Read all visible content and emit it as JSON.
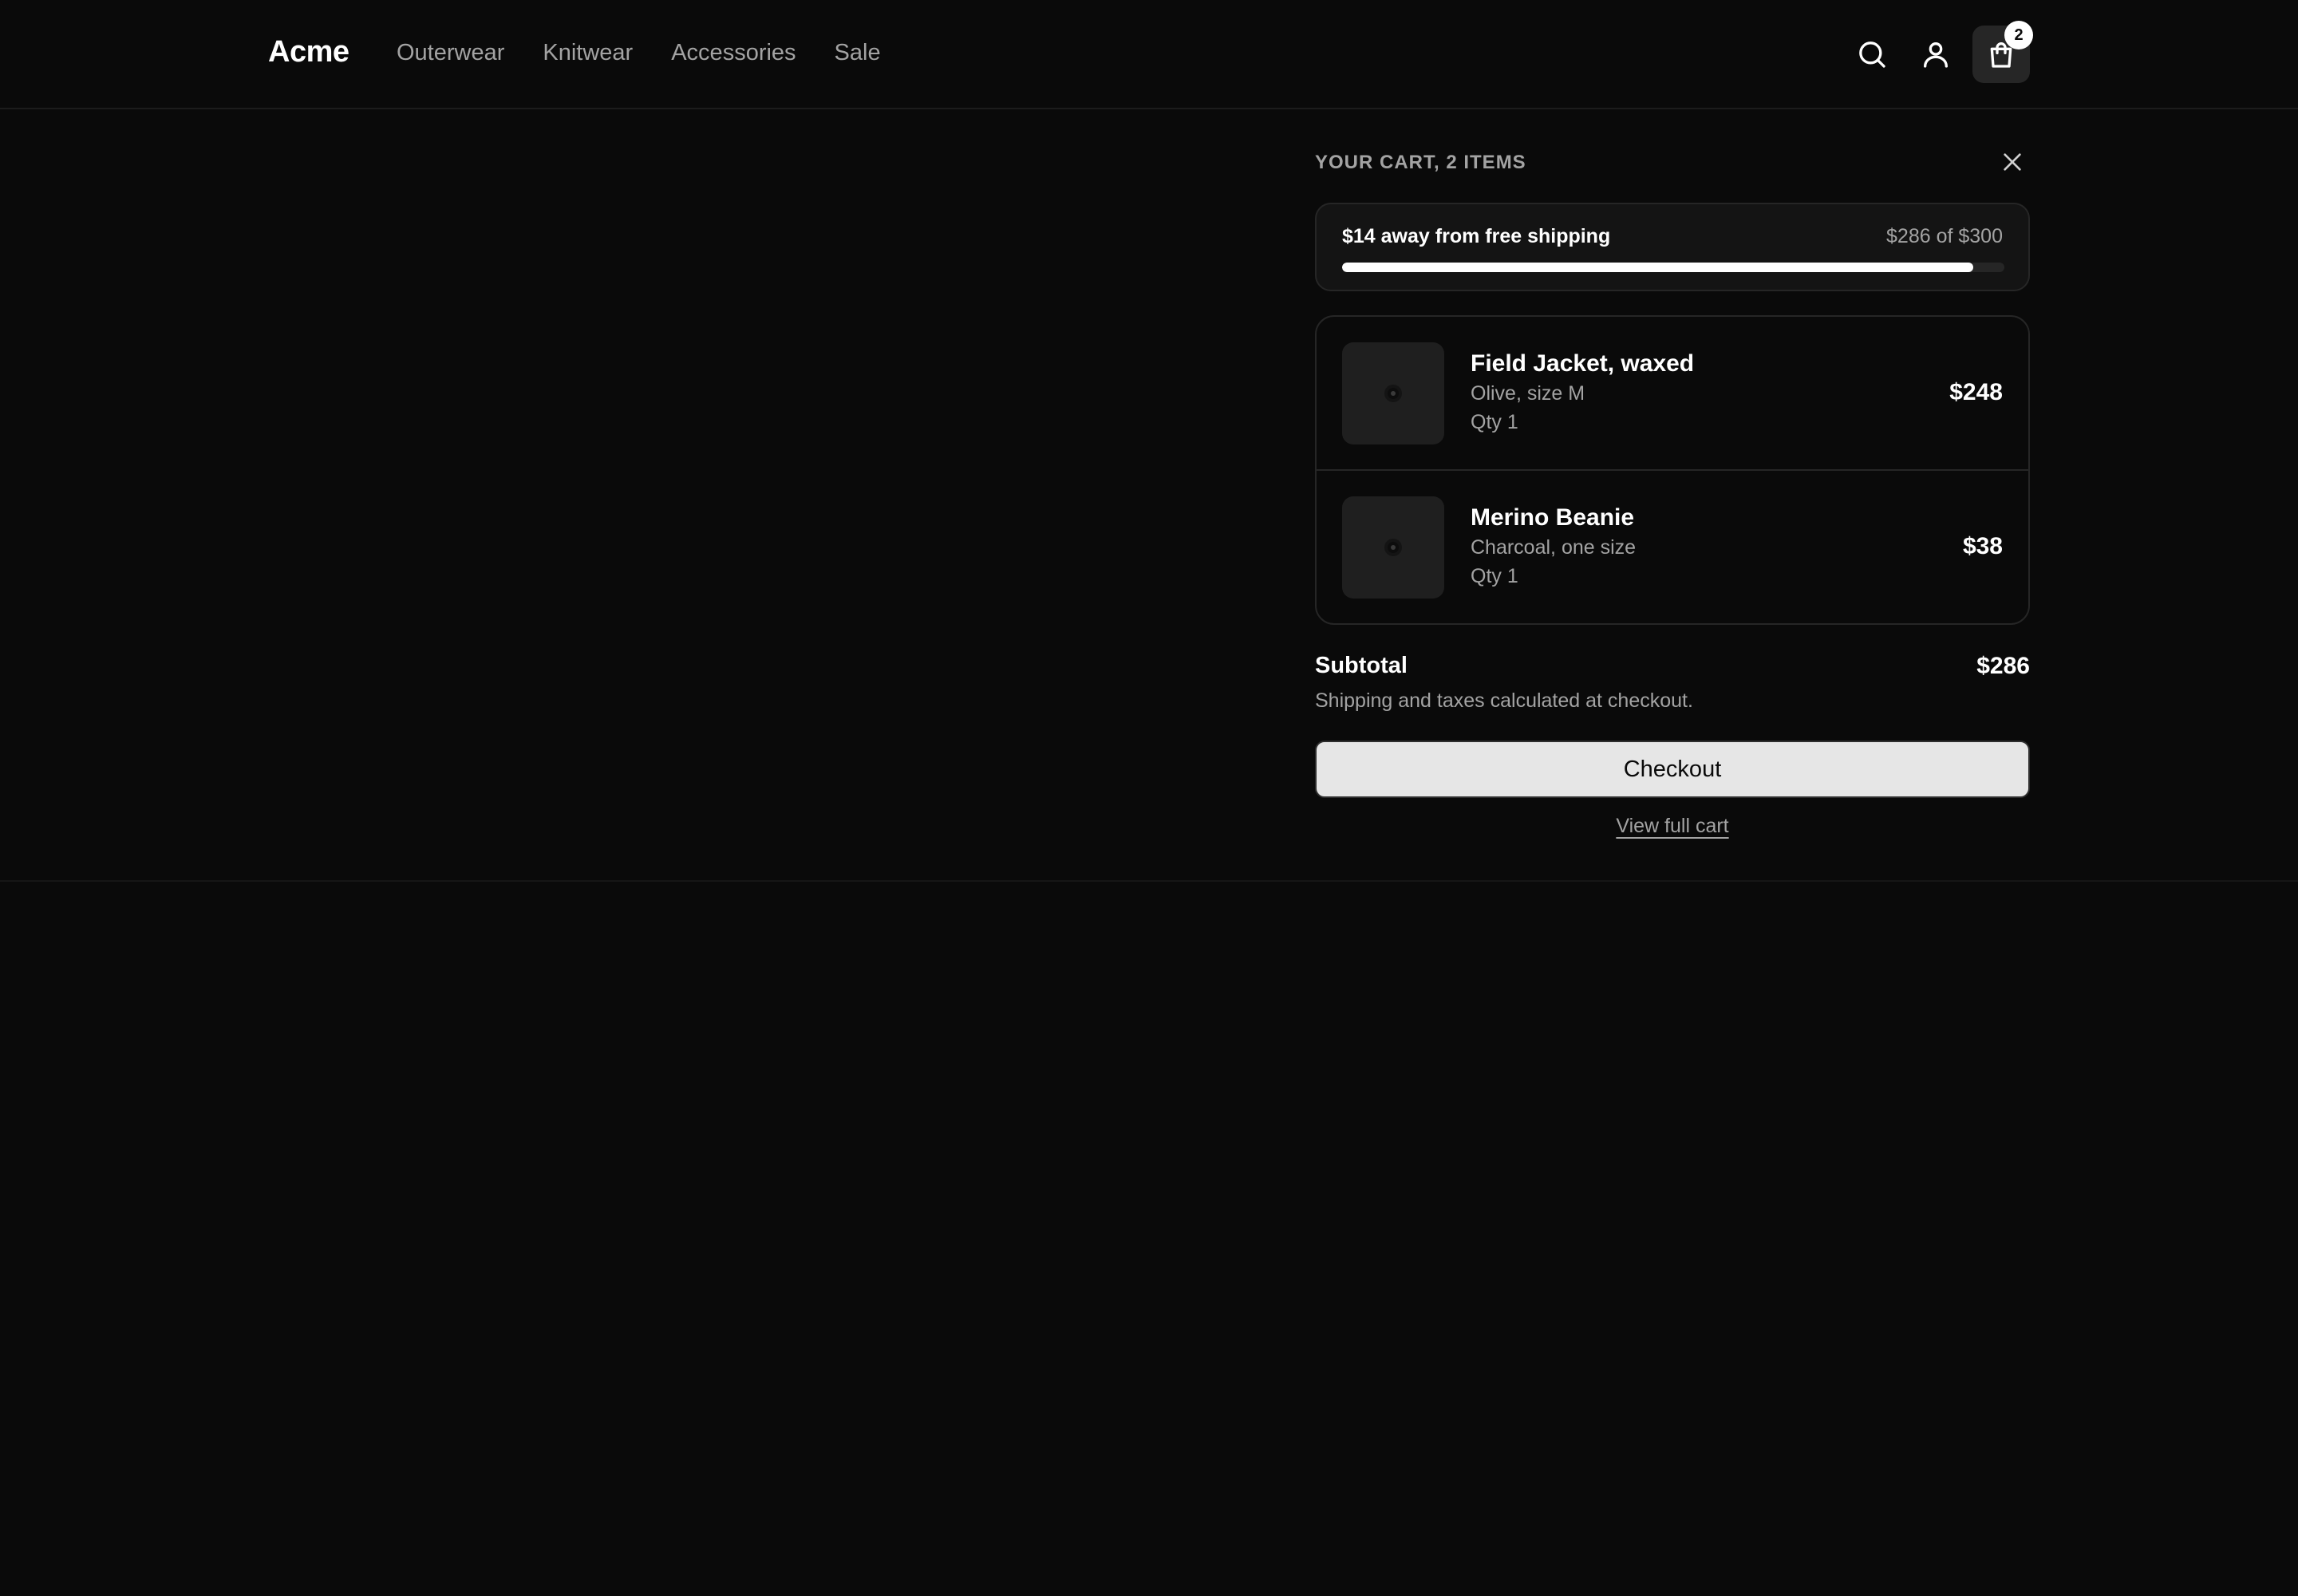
{
  "header": {
    "brand": "Acme",
    "nav": [
      "Outerwear",
      "Knitwear",
      "Accessories",
      "Sale"
    ],
    "icons": {
      "search": "search-icon",
      "account": "user-icon",
      "cart": "shopping-bag-icon"
    },
    "cart_count": "2"
  },
  "cart": {
    "title": "YOUR CART, 2 ITEMS",
    "close_icon": "close-icon",
    "shipping": {
      "message": "$14 away from free shipping",
      "progress_text": "$286 of $300",
      "progress_fraction": 0.9533
    },
    "items": [
      {
        "name": "Field Jacket, waxed",
        "variant": "Olive, size M",
        "qty": "Qty 1",
        "price": "$248"
      },
      {
        "name": "Merino Beanie",
        "variant": "Charcoal, one size",
        "qty": "Qty 1",
        "price": "$38"
      }
    ],
    "subtotal_label": "Subtotal",
    "subtotal_value": "$286",
    "note": "Shipping and taxes calculated at checkout.",
    "checkout_label": "Checkout",
    "view_cart_label": "View full cart"
  },
  "colors": {
    "background": "#0a0a0a",
    "accent": "#ffffff",
    "muted": "#a3a3a3",
    "button": "#e6e6e6"
  }
}
